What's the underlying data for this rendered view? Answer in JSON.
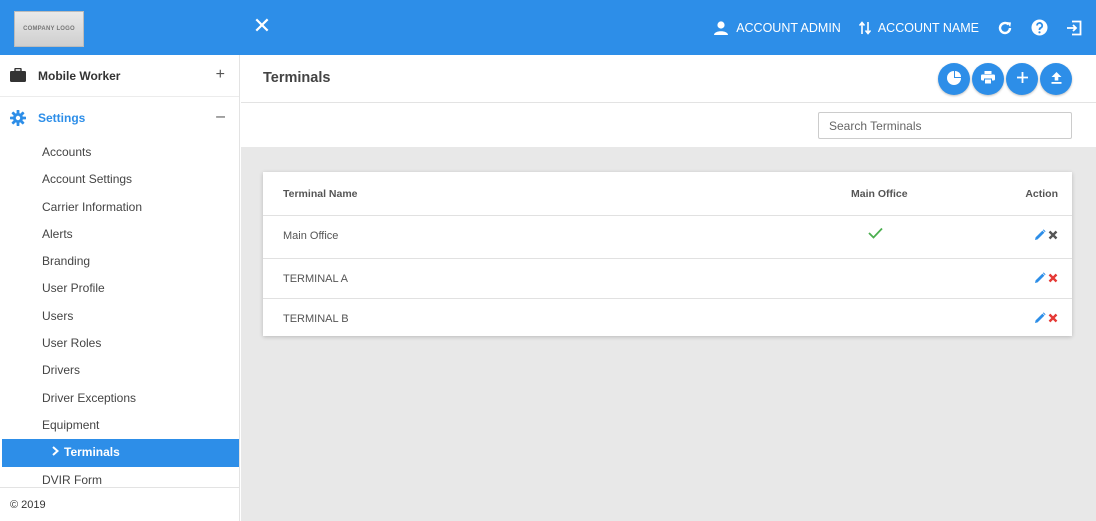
{
  "topbar": {
    "logo_text": "COMPANY LOGO",
    "close_label": "✕",
    "account_admin": "ACCOUNT ADMIN",
    "account_name": "ACCOUNT NAME",
    "accent_color": "#2d8ee8"
  },
  "sidebar": {
    "sections": [
      {
        "label": "Mobile Worker",
        "toggle": "+",
        "icon": "briefcase-icon"
      },
      {
        "label": "Settings",
        "toggle": "–",
        "icon": "gear-icon"
      }
    ],
    "items": [
      {
        "label": "Accounts"
      },
      {
        "label": "Account Settings"
      },
      {
        "label": "Carrier Information"
      },
      {
        "label": "Alerts"
      },
      {
        "label": "Branding"
      },
      {
        "label": "User Profile"
      },
      {
        "label": "Users"
      },
      {
        "label": "User Roles"
      },
      {
        "label": "Drivers"
      },
      {
        "label": "Driver Exceptions"
      },
      {
        "label": "Equipment"
      },
      {
        "label": "Terminals",
        "current": true
      },
      {
        "label": "DVIR Form"
      }
    ],
    "footer": "© 2019"
  },
  "main": {
    "title": "Terminals",
    "buttons": [
      "chart-icon",
      "print-icon",
      "plus-icon",
      "upload-icon"
    ],
    "search": {
      "placeholder": "Search Terminals",
      "value": ""
    },
    "table": {
      "headers": {
        "name": "Terminal Name",
        "main_office": "Main Office",
        "action": "Action"
      },
      "rows": [
        {
          "name": "Main Office",
          "main_office": true
        },
        {
          "name": "TERMINAL A",
          "main_office": false
        },
        {
          "name": "TERMINAL B",
          "main_office": false
        }
      ]
    }
  }
}
